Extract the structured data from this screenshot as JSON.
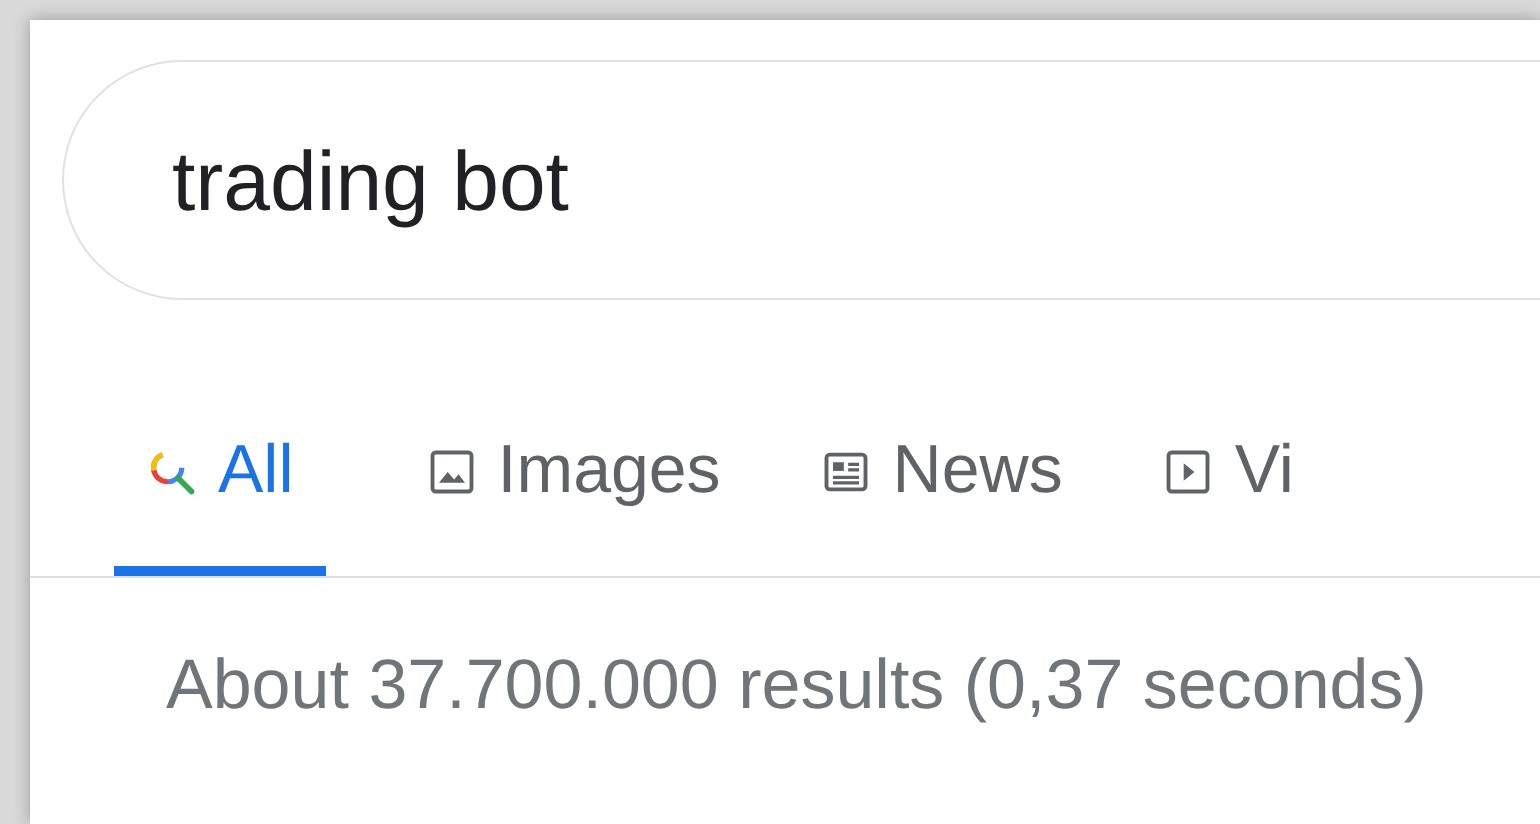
{
  "search": {
    "value": "trading bot"
  },
  "tabs": [
    {
      "label": "All",
      "kind": "search",
      "selected": true
    },
    {
      "label": "Images",
      "kind": "image",
      "selected": false
    },
    {
      "label": "News",
      "kind": "news",
      "selected": false
    },
    {
      "label": "Vi",
      "kind": "video",
      "selected": false
    }
  ],
  "result_stats": "About 37.700.000 results (0,37 seconds)"
}
